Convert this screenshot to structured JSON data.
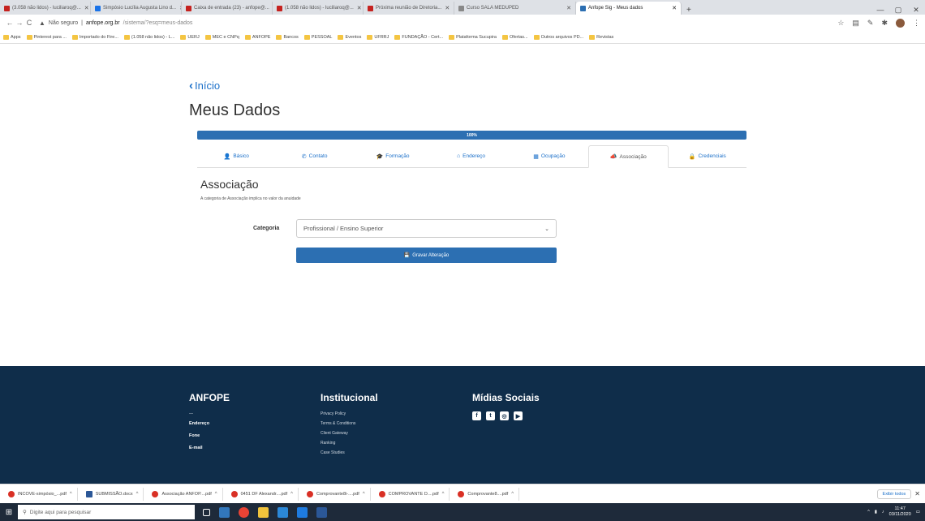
{
  "browser": {
    "tabs": [
      {
        "label": "(3.058 não lidos) - luciliaroq@...",
        "color": "#c5221f"
      },
      {
        "label": "Simpósio Lucília Augusta Lino d...",
        "color": "#1a73e8"
      },
      {
        "label": "Caixa de entrada (23) - anfope@...",
        "color": "#c5221f"
      },
      {
        "label": "(1.058 não lidos) - luciliaroq@...",
        "color": "#c5221f"
      },
      {
        "label": "Próxima reunião de Diretoria...",
        "color": "#c5221f"
      },
      {
        "label": "Curso SALA MEDUPED",
        "color": "#888888"
      },
      {
        "label": "Anfope Sig - Meus dados",
        "color": "#2c6fb2",
        "active": true
      }
    ],
    "new_tab": "+",
    "url_warning": "Não seguro",
    "url_host": "anfope.org.br",
    "url_path": "/sistema/?esq=meus-dados",
    "bookmarks": [
      "Apps",
      "Pinterest para ...",
      "Importado do Fire...",
      "(1.058 não lidos) - L...",
      "UERJ",
      "MEC e CNPq",
      "ANFOPE",
      "Bancos",
      "PESSOAL",
      "Eventos",
      "UFRRJ",
      "FUNDAÇÃO - Cert...",
      "Plataforma Sucupira",
      "Ofertas...",
      "Outros arquivos PD...",
      "Revistas"
    ]
  },
  "page": {
    "back_label": "Início",
    "title": "Meus Dados",
    "progress_label": "100%",
    "progress_value": 100,
    "tabs": [
      {
        "icon": "user-icon",
        "glyph": "👤",
        "label": "Básico"
      },
      {
        "icon": "phone-icon",
        "glyph": "✆",
        "label": "Contato"
      },
      {
        "icon": "graduation-icon",
        "glyph": "🎓",
        "label": "Formação"
      },
      {
        "icon": "home-icon",
        "glyph": "⌂",
        "label": "Endereço"
      },
      {
        "icon": "briefcase-icon",
        "glyph": "▦",
        "label": "Ocupação"
      },
      {
        "icon": "bullhorn-icon",
        "glyph": "📣",
        "label": "Associação",
        "active": true
      },
      {
        "icon": "lock-icon",
        "glyph": "🔒",
        "label": "Credenciais"
      }
    ],
    "section_title": "Associação",
    "section_desc": "A categoria de Associação implica no valor da anuidade",
    "category_label": "Categoria",
    "category_value": "Profissional / Ensino Superior",
    "save_label": "Gravar Alteração"
  },
  "footer": {
    "col1_title": "ANFOPE",
    "col1_items": [
      "Endereço",
      "Fone",
      "E-mail"
    ],
    "col2_title": "Institucional",
    "col2_items": [
      "Privacy Policy",
      "Terms & Conditions",
      "Client Gateway",
      "Ranking",
      "Case Studies"
    ],
    "col3_title": "Mídias Sociais",
    "social": [
      "f",
      "t",
      "◎",
      "▶"
    ]
  },
  "downloads": {
    "items": [
      {
        "type": "pdf",
        "label": "INCOVE-simpósio_...pdf"
      },
      {
        "type": "doc",
        "label": "SUBMISSÃO.docx"
      },
      {
        "type": "pdf",
        "label": "Associação ANFOP....pdf"
      },
      {
        "type": "pdf",
        "label": "0451 DF Alexandr....pdf"
      },
      {
        "type": "pdf",
        "label": "Comprovante8i-....pdf"
      },
      {
        "type": "pdf",
        "label": "COMPROVANTE D....pdf"
      },
      {
        "type": "pdf",
        "label": "Comprovante8....pdf"
      }
    ],
    "show_all": "Exibir todos",
    "close": "✕"
  },
  "taskbar": {
    "search_placeholder": "Digite aqui para pesquisar",
    "time": "11:47",
    "date": "03/11/2020"
  }
}
